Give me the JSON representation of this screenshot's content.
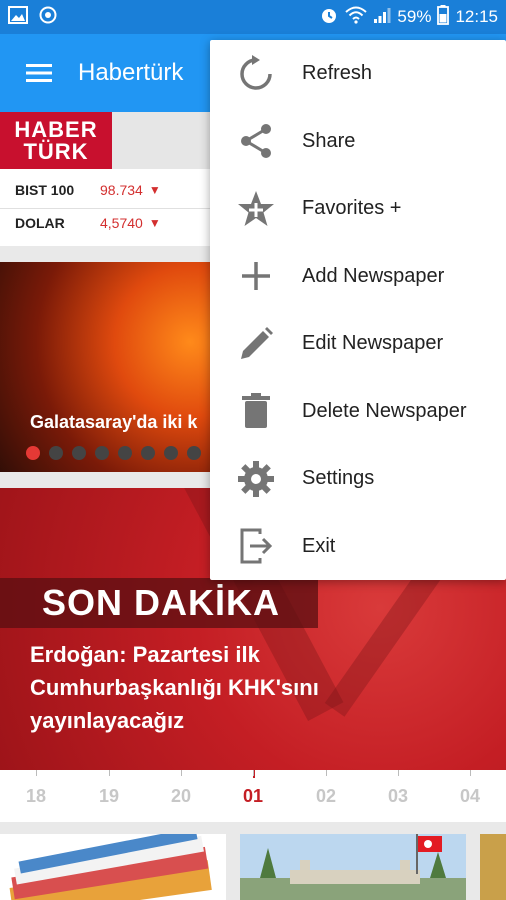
{
  "status_bar": {
    "battery": "59%",
    "time": "12:15",
    "icons": [
      "image-icon",
      "sync-icon",
      "alarm-icon",
      "wifi-icon",
      "signal-icon",
      "battery-icon"
    ]
  },
  "app_bar": {
    "title": "Habertürk",
    "menu_icon": "hamburger-menu-icon"
  },
  "logo": {
    "line1": "HABER",
    "line2": "TÜRK"
  },
  "ticker": [
    {
      "name": "BIST 100",
      "value": "98.734",
      "trend": "down"
    },
    {
      "name": "DOLAR",
      "value": "4,5740",
      "trend": "down"
    }
  ],
  "slider": {
    "caption": "Galatasaray'da iki k",
    "dot_count": 8,
    "active_dot": 0
  },
  "breaking": {
    "label": "SON DAKİKA",
    "text_line1": "Erdoğan: Pazartesi ilk",
    "text_line2": "Cumhurbaşkanlığı KHK'sını",
    "text_line3": "yayınlayacağız"
  },
  "dates": [
    "18",
    "19",
    "20",
    "01",
    "02",
    "03",
    "04"
  ],
  "active_date": "01",
  "overflow_menu": {
    "items": [
      {
        "label": "Refresh",
        "icon": "refresh-icon"
      },
      {
        "label": "Share",
        "icon": "share-icon"
      },
      {
        "label": "Favorites +",
        "icon": "favorite-star-icon"
      },
      {
        "label": "Add Newspaper",
        "icon": "plus-icon"
      },
      {
        "label": "Edit Newspaper",
        "icon": "pencil-icon"
      },
      {
        "label": "Delete Newspaper",
        "icon": "trash-icon"
      },
      {
        "label": "Settings",
        "icon": "gear-icon"
      },
      {
        "label": "Exit",
        "icon": "exit-icon"
      }
    ]
  },
  "colors": {
    "status_bar": "#1a7fd8",
    "app_bar": "#2196f3",
    "brand_red": "#c8102e",
    "down_red": "#d32f2f",
    "icon_gray": "#757575"
  }
}
